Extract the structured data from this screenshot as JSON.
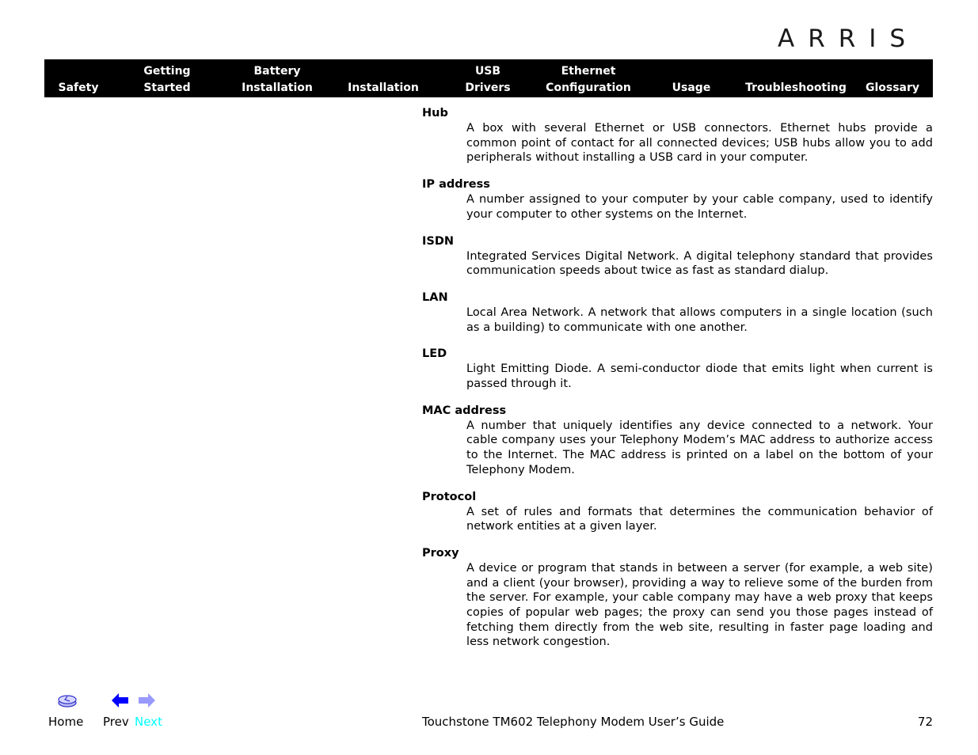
{
  "brand": {
    "logo_text": "ARRIS"
  },
  "nav": {
    "items": [
      {
        "line1": "",
        "line2": "Safety"
      },
      {
        "line1": "Getting",
        "line2": "Started"
      },
      {
        "line1": "Battery",
        "line2": "Installation"
      },
      {
        "line1": "",
        "line2": "Installation"
      },
      {
        "line1": "USB",
        "line2": "Drivers"
      },
      {
        "line1": "Ethernet",
        "line2": "Configuration"
      },
      {
        "line1": "",
        "line2": "Usage"
      },
      {
        "line1": "",
        "line2": "Troubleshooting"
      },
      {
        "line1": "",
        "line2": "Glossary"
      }
    ]
  },
  "glossary": [
    {
      "term": "Hub",
      "definition": "A box with several Ethernet or USB connectors. Ethernet hubs provide a common point of contact for all connected devices; USB hubs allow you to add peripherals without installing a USB card in your computer."
    },
    {
      "term": "IP address",
      "definition": "A number assigned to your computer by your cable company, used to identify your computer to other systems on the Internet."
    },
    {
      "term": "ISDN",
      "definition": "Integrated Services Digital Network. A digital telephony standard that provides communication speeds about twice as fast as standard dialup."
    },
    {
      "term": "LAN",
      "definition": "Local Area Network. A network that allows computers in a single location (such as a building) to communicate with one another."
    },
    {
      "term": "LED",
      "definition": "Light Emitting Diode. A semi-conductor diode that emits light when current is passed through it."
    },
    {
      "term": "MAC address",
      "definition": "A number that uniquely identifies any device connected to a network. Your cable company uses your Telephony Modem’s MAC address to authorize access to the Internet. The MAC address is printed on a label on the bottom of your Telephony Modem."
    },
    {
      "term": "Protocol",
      "definition": "A set of rules and formats that determines the communication behavior of network entities at a given layer."
    },
    {
      "term": "Proxy",
      "definition": "A device or program that stands in between a server (for example, a web site) and a client (your browser), providing a way to relieve some of the burden from the server. For example, your cable company may have a web proxy that keeps copies of popular web pages; the proxy can send you those pages instead of fetching them directly from the web site, resulting in faster page loading and less network congestion."
    }
  ],
  "footer": {
    "home_label": "Home",
    "prev_label": "Prev",
    "next_label": "Next",
    "home_icon": "home-disc-icon",
    "prev_icon": "arrow-left-icon",
    "next_icon": "arrow-right-icon",
    "doc_title": "Touchstone TM602 Telephony Modem User’s Guide",
    "page_number": "72"
  },
  "colors": {
    "nav_bg": "#000000",
    "nav_text": "#ffffff",
    "prev_arrow": "#0000ff",
    "next_arrow": "#9999ff",
    "next_link": "#00ffff",
    "home_icon": "#3333cc"
  }
}
